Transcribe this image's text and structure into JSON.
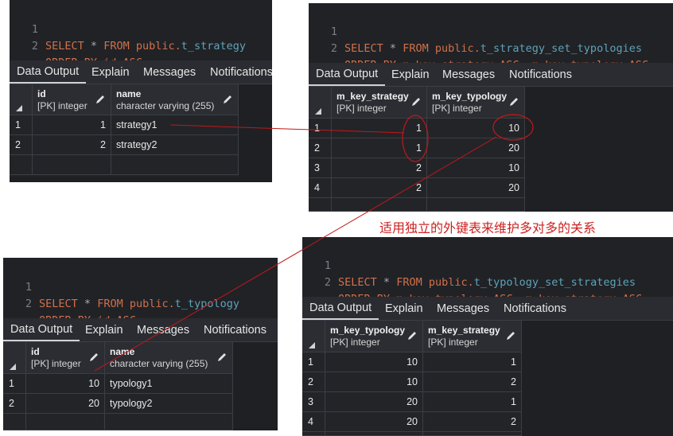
{
  "tab_labels": {
    "data_output": "Data Output",
    "explain": "Explain",
    "messages": "Messages",
    "notifications": "Notifications"
  },
  "annotation": "适用独立的外键表来维护多对多的关系",
  "panels": {
    "strategy": {
      "line_numbers": [
        "1",
        "2"
      ],
      "sql": {
        "select": "SELECT",
        "star": "*",
        "from": "FROM",
        "schema": "public.",
        "table": "t_strategy",
        "order_by": "ORDER BY",
        "order_rest": "id ASC"
      },
      "columns": [
        {
          "name": "id",
          "type": "[PK] integer"
        },
        {
          "name": "name",
          "type": "character varying (255)"
        }
      ],
      "rows": [
        {
          "n": "1",
          "a": "1",
          "b": "strategy1"
        },
        {
          "n": "2",
          "a": "2",
          "b": "strategy2"
        }
      ]
    },
    "set_typologies": {
      "line_numbers": [
        "1",
        "2"
      ],
      "sql": {
        "select": "SELECT",
        "star": "*",
        "from": "FROM",
        "schema": "public.",
        "table": "t_strategy_set_typologies",
        "order_by": "ORDER BY",
        "order_rest": "m_key_strategy ASC, m_key_typology ASC"
      },
      "columns": [
        {
          "name": "m_key_strategy",
          "type": "[PK] integer"
        },
        {
          "name": "m_key_typology",
          "type": "[PK] integer"
        }
      ],
      "rows": [
        {
          "n": "1",
          "a": "1",
          "b": "10"
        },
        {
          "n": "2",
          "a": "1",
          "b": "20"
        },
        {
          "n": "3",
          "a": "2",
          "b": "10"
        },
        {
          "n": "4",
          "a": "2",
          "b": "20"
        }
      ]
    },
    "typology": {
      "line_numbers": [
        "1",
        "2"
      ],
      "sql": {
        "select": "SELECT",
        "star": "*",
        "from": "FROM",
        "schema": "public.",
        "table": "t_typology",
        "order_by": "ORDER BY",
        "order_rest": "id ASC"
      },
      "columns": [
        {
          "name": "id",
          "type": "[PK] integer"
        },
        {
          "name": "name",
          "type": "character varying (255)"
        }
      ],
      "rows": [
        {
          "n": "1",
          "a": "10",
          "b": "typology1"
        },
        {
          "n": "2",
          "a": "20",
          "b": "typology2"
        }
      ]
    },
    "set_strategies": {
      "line_numbers": [
        "1",
        "2"
      ],
      "sql": {
        "select": "SELECT",
        "star": "*",
        "from": "FROM",
        "schema": "public.",
        "table": "t_typology_set_strategies",
        "order_by": "ORDER BY",
        "order_rest": "m_key_typology ASC, m_key_strategy ASC"
      },
      "columns": [
        {
          "name": "m_key_typology",
          "type": "[PK] integer"
        },
        {
          "name": "m_key_strategy",
          "type": "[PK] integer"
        }
      ],
      "rows": [
        {
          "n": "1",
          "a": "10",
          "b": "1"
        },
        {
          "n": "2",
          "a": "10",
          "b": "2"
        },
        {
          "n": "3",
          "a": "20",
          "b": "1"
        },
        {
          "n": "4",
          "a": "20",
          "b": "2"
        }
      ]
    }
  }
}
